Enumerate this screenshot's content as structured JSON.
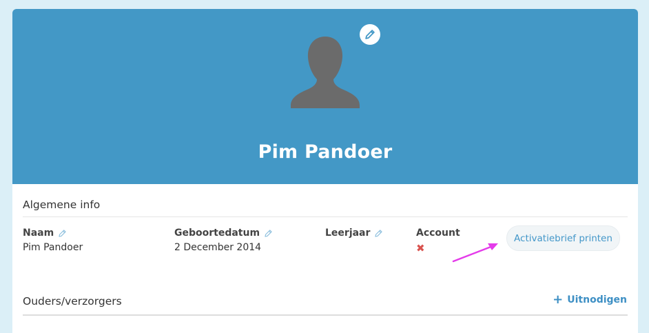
{
  "profile": {
    "name": "Pim Pandoer",
    "hero_color": "#4398c6",
    "avatar_icon": "user-silhouette-icon",
    "edit_icon": "pencil-icon"
  },
  "general_info": {
    "title": "Algemene info",
    "fields": [
      {
        "label": "Naam",
        "value": "Pim Pandoer",
        "editable": true
      },
      {
        "label": "Geboortedatum",
        "value": "2 December 2014",
        "editable": true
      },
      {
        "label": "Leerjaar",
        "value": "",
        "editable": true
      },
      {
        "label": "Account",
        "value": "✖",
        "status": "no-account",
        "status_color": "#d9534f"
      }
    ],
    "activation_button": "Activatiebrief printen",
    "annotation_arrow_color": "#e43bea"
  },
  "parents": {
    "title": "Ouders/verzorgers",
    "invite_label": "Uitnodigen",
    "invite_icon": "plus-icon",
    "accent_color": "#3d8fc4"
  }
}
